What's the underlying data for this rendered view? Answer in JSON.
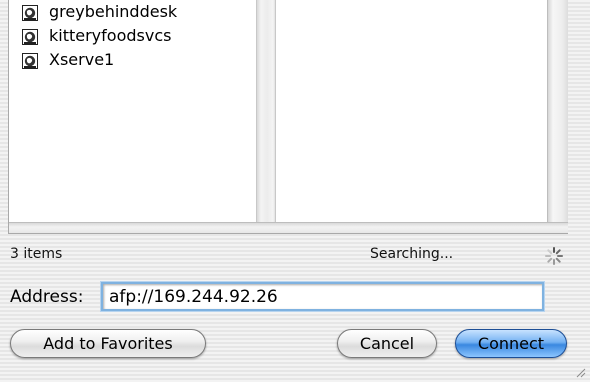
{
  "browser": {
    "servers": [
      {
        "name": "greybehinddesk",
        "icon": "network-globe-icon"
      },
      {
        "name": "kitteryfoodsvcs",
        "icon": "network-globe-icon"
      },
      {
        "name": "Xserve1",
        "icon": "network-globe-icon"
      }
    ]
  },
  "status": {
    "item_count": "3 items",
    "search_text": "Searching..."
  },
  "address": {
    "label": "Address:",
    "value": "afp://169.244.92.26"
  },
  "buttons": {
    "add_to_favorites": "Add to Favorites",
    "cancel": "Cancel",
    "connect": "Connect"
  },
  "colors": {
    "default_button": "#5a9ee8",
    "focus_ring": "#7fb2e0"
  }
}
